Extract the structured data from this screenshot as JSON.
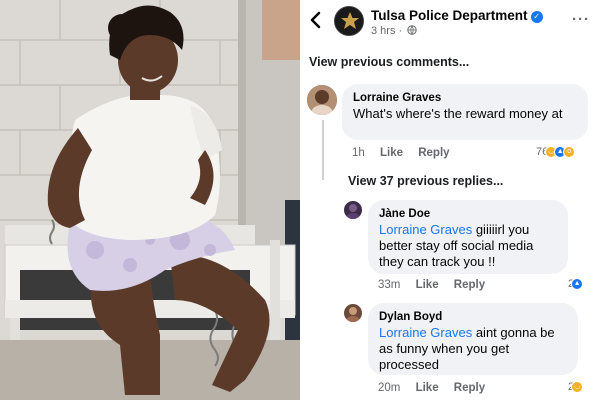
{
  "post": {
    "page_name": "Tulsa Police Department",
    "time": "3 hrs ·",
    "privacy_icon": "globe-icon",
    "more_label": "···"
  },
  "view_previous_comments": "View previous comments...",
  "comments": [
    {
      "author": "Lorraine Graves",
      "text": "What's where's the reward money at",
      "time": "1h",
      "like": "Like",
      "reply": "Reply",
      "reaction_count": "76",
      "reactions": [
        "haha",
        "like",
        "wow"
      ]
    }
  ],
  "view_replies": "View 37 previous replies...",
  "replies": [
    {
      "author": "Jàne Doe",
      "mention": "Lorraine Graves",
      "text": " giiiiirl you better stay off social media they can track you !!",
      "time": "33m",
      "like": "Like",
      "reply": "Reply",
      "reaction_count": "2",
      "reactions": [
        "like"
      ]
    },
    {
      "author": "Dylan Boyd",
      "mention": "Lorraine Graves",
      "text": " aint gonna be as funny when you get processed",
      "time": "20m",
      "like": "Like",
      "reply": "Reply",
      "reaction_count": "2",
      "reactions": [
        "haha"
      ]
    }
  ],
  "colors": {
    "link_blue": "#1877f2",
    "bubble_gray": "#f0f2f5",
    "meta_gray": "#65676b"
  }
}
